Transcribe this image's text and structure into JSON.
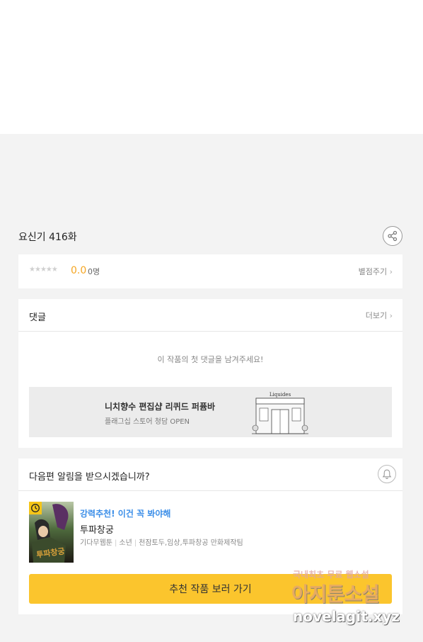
{
  "episode": {
    "title": "요신기 416화"
  },
  "icons": {
    "share": "share-icon",
    "bell": "bell-icon",
    "clock": "clock-icon",
    "chevron": "chevron-right-icon",
    "star": "star-icon"
  },
  "rating": {
    "stars_value": 0,
    "stars_max": 5,
    "score": "0.0",
    "count": "0명",
    "rate_link": "별점주기"
  },
  "comments": {
    "title": "댓글",
    "more_label": "더보기",
    "empty_message": "이 작품의 첫 댓글을 남겨주세요!",
    "banner": {
      "title": "니치향수 편집샵 리퀴드 퍼퓸바",
      "subtitle": "플래그십 스토어 청담 OPEN",
      "sign_text": "Liquides"
    }
  },
  "notification": {
    "question": "다음편 알림을 받으시겠습니까?",
    "recommend_label": "강력추천! 이건 꼭 봐야해",
    "work_title": "투파창궁",
    "meta": [
      "기다무웹툰",
      "소년",
      "천잠토두,임상,투파창공 만화제작팀"
    ],
    "cover_text": "투파창궁",
    "cta_label": "추천 작품 보러 가기"
  },
  "watermark": {
    "line1": "국내최초 무료 웹소설",
    "line2": "아지툰소설",
    "line3": "novelagit.xyz"
  },
  "colors": {
    "accent_yellow": "#fbc52d",
    "score_orange": "#f5a623",
    "link_blue": "#3b8ee8",
    "background": "#f3f3f3"
  }
}
